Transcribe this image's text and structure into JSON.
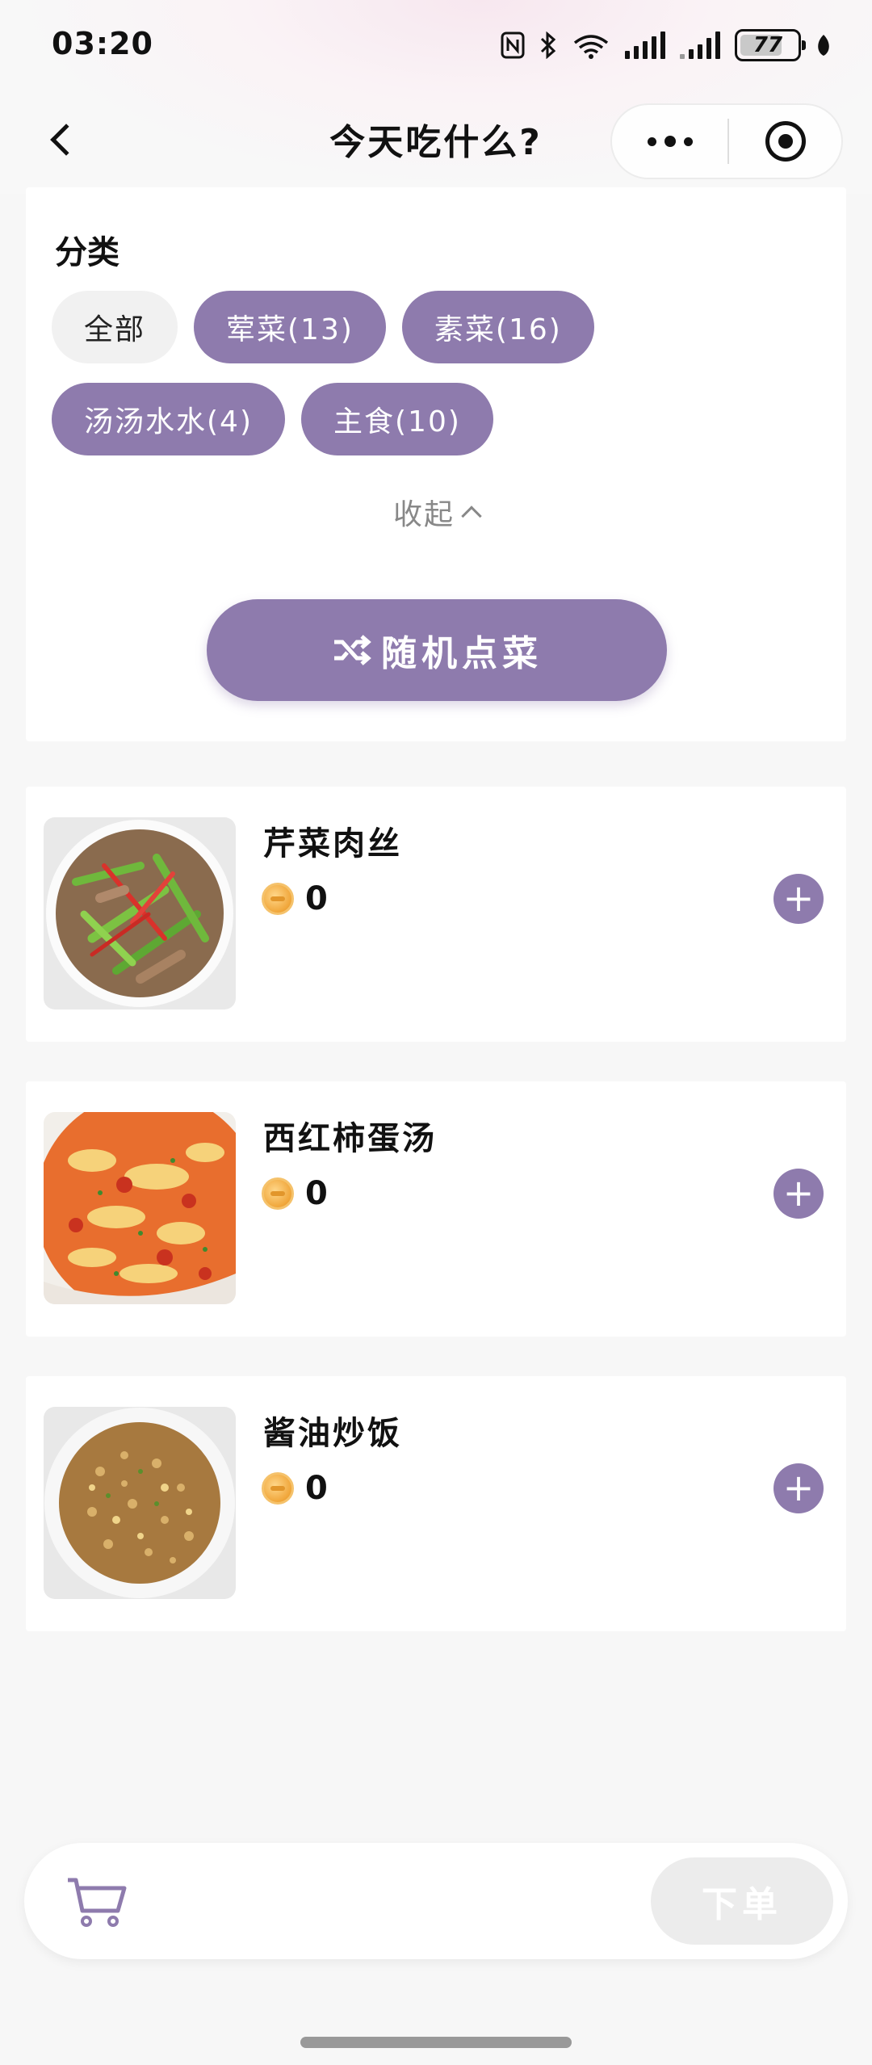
{
  "status_bar": {
    "time": "03:20",
    "battery_level": 77,
    "battery_text": "77",
    "icons": [
      "nfc-icon",
      "bluetooth-icon",
      "wifi-6-icon",
      "signal-icon",
      "signal-2-icon",
      "battery-icon",
      "leaf-icon"
    ]
  },
  "nav": {
    "title": "今天吃什么?"
  },
  "category": {
    "title": "分类",
    "chips": [
      {
        "label": "全部",
        "active": true
      },
      {
        "label": "荤菜(13)",
        "active": false
      },
      {
        "label": "素菜(16)",
        "active": false
      },
      {
        "label": "汤汤水水(4)",
        "active": false
      },
      {
        "label": "主食(10)",
        "active": false
      }
    ],
    "collapse_label": "收起",
    "random_label": "随机点菜"
  },
  "dishes": [
    {
      "name": "芹菜肉丝",
      "price": "0"
    },
    {
      "name": "西红柿蛋汤",
      "price": "0"
    },
    {
      "name": "酱油炒饭",
      "price": "0"
    }
  ],
  "cart": {
    "order_label": "下单"
  },
  "colors": {
    "accent": "#8e7bad",
    "chip_inactive_bg": "#f1f1f1",
    "page_bg": "#f7f7f7",
    "order_disabled": "#ececec"
  }
}
